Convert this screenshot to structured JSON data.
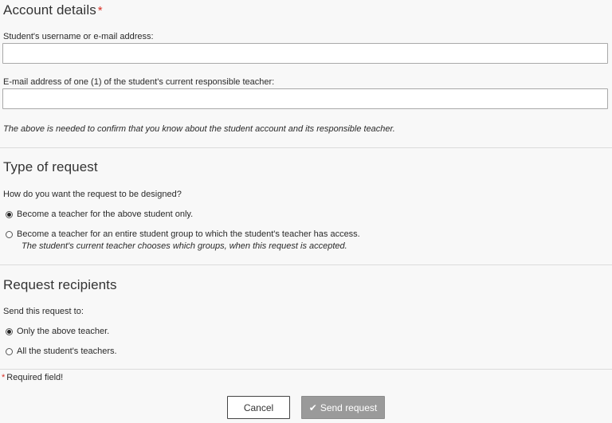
{
  "account_details": {
    "title": "Account details",
    "required_marker": "*",
    "username_label": "Student's username or e-mail address:",
    "username_value": "",
    "teacher_email_label": "E-mail address of one (1) of the student's current responsible teacher:",
    "teacher_email_value": "",
    "note": "The above is needed to confirm that you know about the student account and its responsible teacher."
  },
  "type_of_request": {
    "title": "Type of request",
    "question": "How do you want the request to be designed?",
    "options": [
      {
        "label": "Become a teacher for the above student only.",
        "checked": true
      },
      {
        "label": "Become a teacher for an entire student group to which the student's teacher has access.",
        "checked": false,
        "note": "The student's current teacher chooses which groups, when this request is accepted."
      }
    ]
  },
  "request_recipients": {
    "title": "Request recipients",
    "question": "Send this request to:",
    "options": [
      {
        "label": "Only the above teacher.",
        "checked": true
      },
      {
        "label": "All the student's teachers.",
        "checked": false
      }
    ]
  },
  "footer": {
    "required_marker": "*",
    "required_note": "Required field!",
    "cancel_label": "Cancel",
    "send_label": "Send request",
    "send_icon": "check-icon"
  },
  "colors": {
    "background": "#f8f8f8",
    "required_star": "#d93025",
    "send_button_bg": "#9a9a9a"
  }
}
